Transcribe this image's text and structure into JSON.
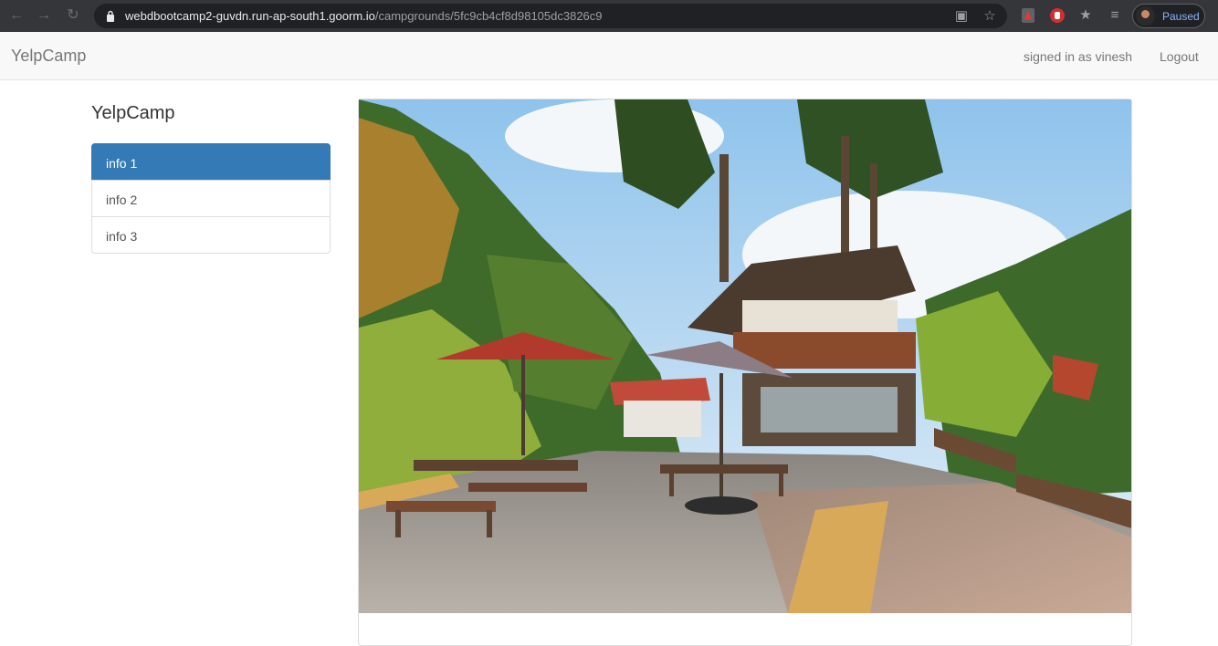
{
  "browser": {
    "url_host": "webdbootcamp2-guvdn.run-ap-south1.goorm.io",
    "url_path": "/campgrounds/5fc9cb4cf8d98105dc3826c9",
    "profile_status": "Paused"
  },
  "navbar": {
    "brand": "YelpCamp",
    "signed_in_text": "signed in as vinesh",
    "logout_label": "Logout"
  },
  "sidebar": {
    "title": "YelpCamp",
    "items": [
      {
        "label": "info 1",
        "active": true
      },
      {
        "label": "info 2",
        "active": false
      },
      {
        "label": "info 3",
        "active": false
      }
    ]
  },
  "campground": {
    "image_subject": "campground lodge with wooden deck, umbrellas and forest"
  },
  "colors": {
    "active": "#337ab7",
    "chrome": "#35363a",
    "navbar": "#f8f8f8"
  }
}
